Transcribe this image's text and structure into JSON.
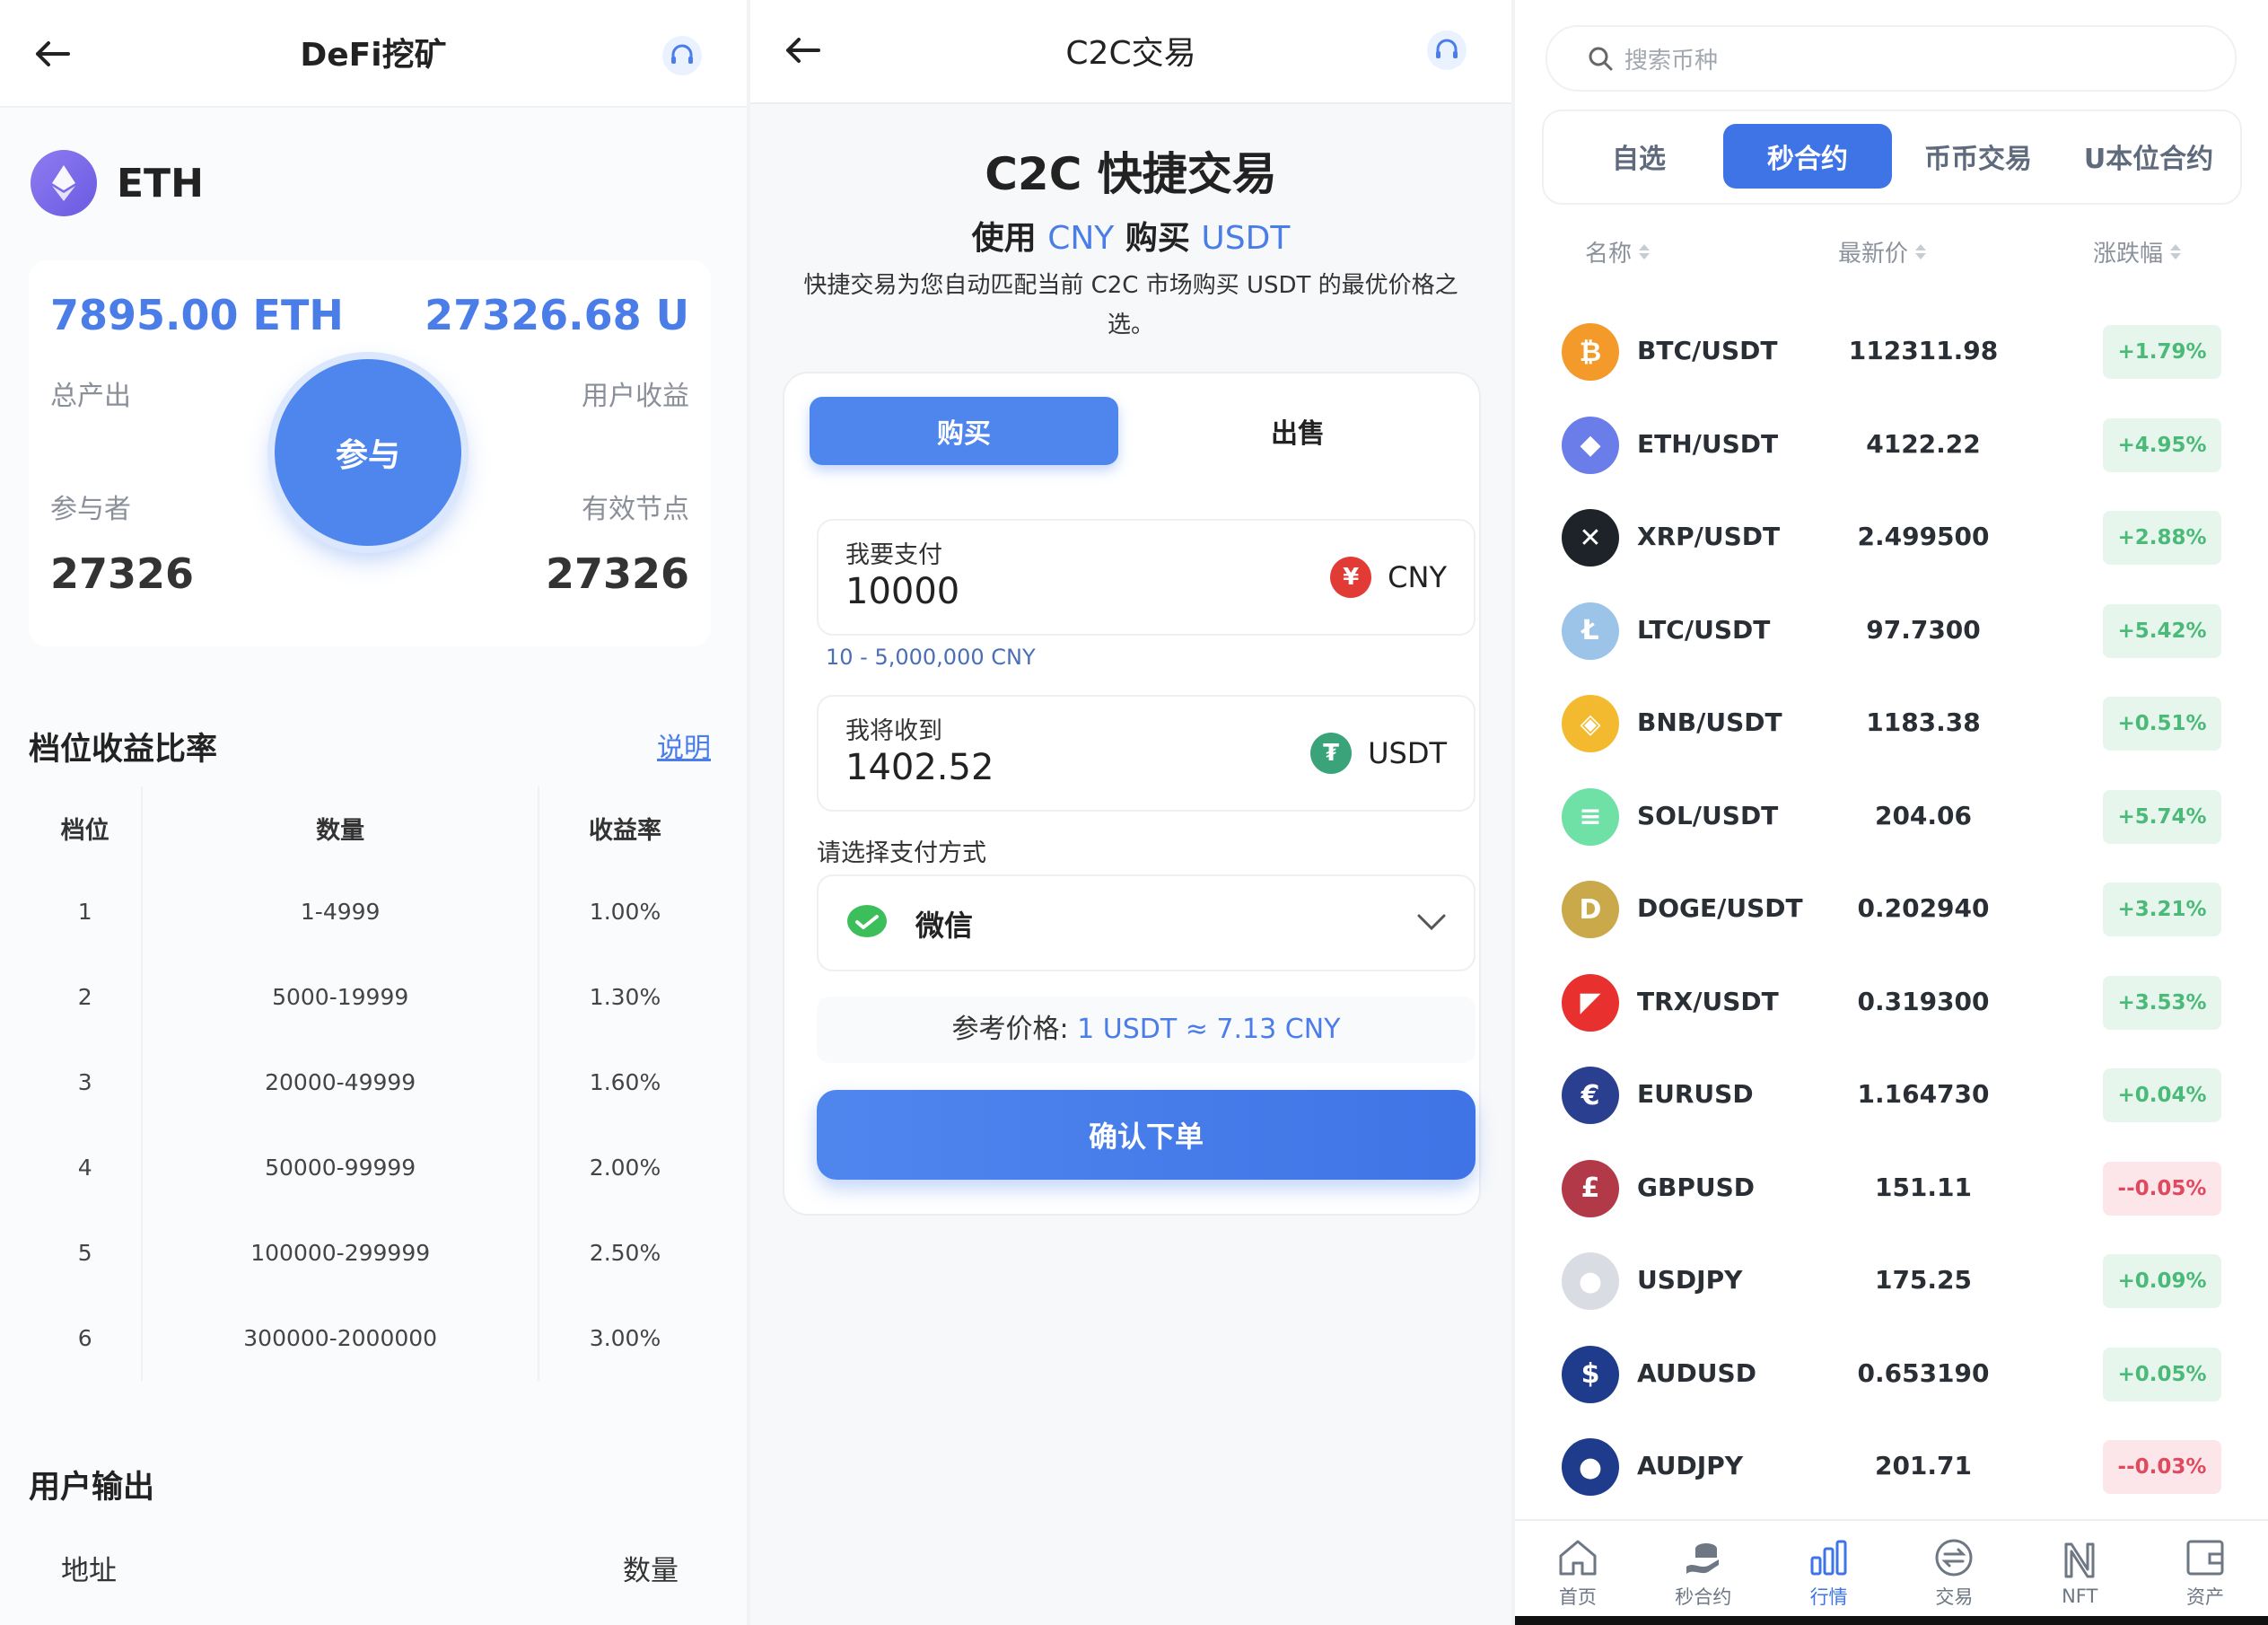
{
  "defi": {
    "title": "DeFi挖矿",
    "coin": "ETH",
    "total_output_value": "7895.00 ETH",
    "user_income_value": "27326.68 U",
    "total_output_label": "总产出",
    "user_income_label": "用户收益",
    "participants_label": "参与者",
    "nodes_label": "有效节点",
    "participants_value": "27326",
    "nodes_value": "27326",
    "join_label": "参与",
    "tier_title": "档位收益比率",
    "explain_link": "说明",
    "table_headers": [
      "档位",
      "数量",
      "收益率"
    ],
    "tiers": [
      {
        "level": "1",
        "range": "1-4999",
        "rate": "1.00%"
      },
      {
        "level": "2",
        "range": "5000-19999",
        "rate": "1.30%"
      },
      {
        "level": "3",
        "range": "20000-49999",
        "rate": "1.60%"
      },
      {
        "level": "4",
        "range": "50000-99999",
        "rate": "2.00%"
      },
      {
        "level": "5",
        "range": "100000-299999",
        "rate": "2.50%"
      },
      {
        "level": "6",
        "range": "300000-2000000",
        "rate": "3.00%"
      }
    ],
    "output_title": "用户输出",
    "output_headers": [
      "地址",
      "数量"
    ]
  },
  "c2c": {
    "title": "C2C交易",
    "heading": "C2C 快捷交易",
    "sub_prefix": "使用",
    "sub_cny": "CNY",
    "sub_mid": "购买",
    "sub_usdt": "USDT",
    "desc": "快捷交易为您自动匹配当前 C2C 市场购买 USDT 的最优价格之选。",
    "buy_tab": "购买",
    "sell_tab": "出售",
    "pay_label": "我要支付",
    "pay_value": "10000",
    "pay_currency": "CNY",
    "range": "10 - 5,000,000 CNY",
    "receive_label": "我将收到",
    "receive_value": "1402.52",
    "receive_currency": "USDT",
    "method_label": "请选择支付方式",
    "method_value": "微信",
    "ref_label": "参考价格:",
    "ref_value": "1 USDT ≈ 7.13 CNY",
    "confirm": "确认下单"
  },
  "market": {
    "search_placeholder": "搜索币种",
    "tabs": [
      "自选",
      "秒合约",
      "币币交易",
      "U本位合约"
    ],
    "active_tab": 1,
    "col_name": "名称",
    "col_price": "最新价",
    "col_change": "涨跌幅",
    "rows": [
      {
        "pair": "BTC/USDT",
        "price": "112311.98",
        "change": "+1.79%",
        "dir": "up",
        "color": "#f39a2b",
        "glyph": "₿"
      },
      {
        "pair": "ETH/USDT",
        "price": "4122.22",
        "change": "+4.95%",
        "dir": "up",
        "color": "#6a7de8",
        "glyph": "◆"
      },
      {
        "pair": "XRP/USDT",
        "price": "2.499500",
        "change": "+2.88%",
        "dir": "up",
        "color": "#1e2329",
        "glyph": "✕"
      },
      {
        "pair": "LTC/USDT",
        "price": "97.7300",
        "change": "+5.42%",
        "dir": "up",
        "color": "#9cc3e8",
        "glyph": "Ł"
      },
      {
        "pair": "BNB/USDT",
        "price": "1183.38",
        "change": "+0.51%",
        "dir": "up",
        "color": "#f3ba2f",
        "glyph": "◈"
      },
      {
        "pair": "SOL/USDT",
        "price": "204.06",
        "change": "+5.74%",
        "dir": "up",
        "color": "#6fe0a6",
        "glyph": "≡"
      },
      {
        "pair": "DOGE/USDT",
        "price": "0.202940",
        "change": "+3.21%",
        "dir": "up",
        "color": "#c9a94a",
        "glyph": "D"
      },
      {
        "pair": "TRX/USDT",
        "price": "0.319300",
        "change": "+3.53%",
        "dir": "up",
        "color": "#e8302f",
        "glyph": "◤"
      },
      {
        "pair": "EURUSD",
        "price": "1.164730",
        "change": "+0.04%",
        "dir": "up",
        "color": "#2a3f8f",
        "glyph": "€"
      },
      {
        "pair": "GBPUSD",
        "price": "151.11",
        "change": "--0.05%",
        "dir": "down",
        "color": "#b23a48",
        "glyph": "£"
      },
      {
        "pair": "USDJPY",
        "price": "175.25",
        "change": "+0.09%",
        "dir": "up",
        "color": "#d9dde3",
        "glyph": "●"
      },
      {
        "pair": "AUDUSD",
        "price": "0.653190",
        "change": "+0.05%",
        "dir": "up",
        "color": "#1f3b8c",
        "glyph": "$"
      },
      {
        "pair": "AUDJPY",
        "price": "201.71",
        "change": "--0.03%",
        "dir": "down",
        "color": "#1f3b8c",
        "glyph": "●"
      }
    ],
    "nav": [
      {
        "label": "首页",
        "icon": "home-icon"
      },
      {
        "label": "秒合约",
        "icon": "contract-icon"
      },
      {
        "label": "行情",
        "icon": "chart-bar-icon"
      },
      {
        "label": "交易",
        "icon": "exchange-icon"
      },
      {
        "label": "NFT",
        "icon": "nft-icon"
      },
      {
        "label": "资产",
        "icon": "wallet-icon"
      }
    ],
    "active_nav": 2
  },
  "colors": {
    "accent": "#4f86ee",
    "up": "#4bb978",
    "down": "#e04a5e"
  }
}
